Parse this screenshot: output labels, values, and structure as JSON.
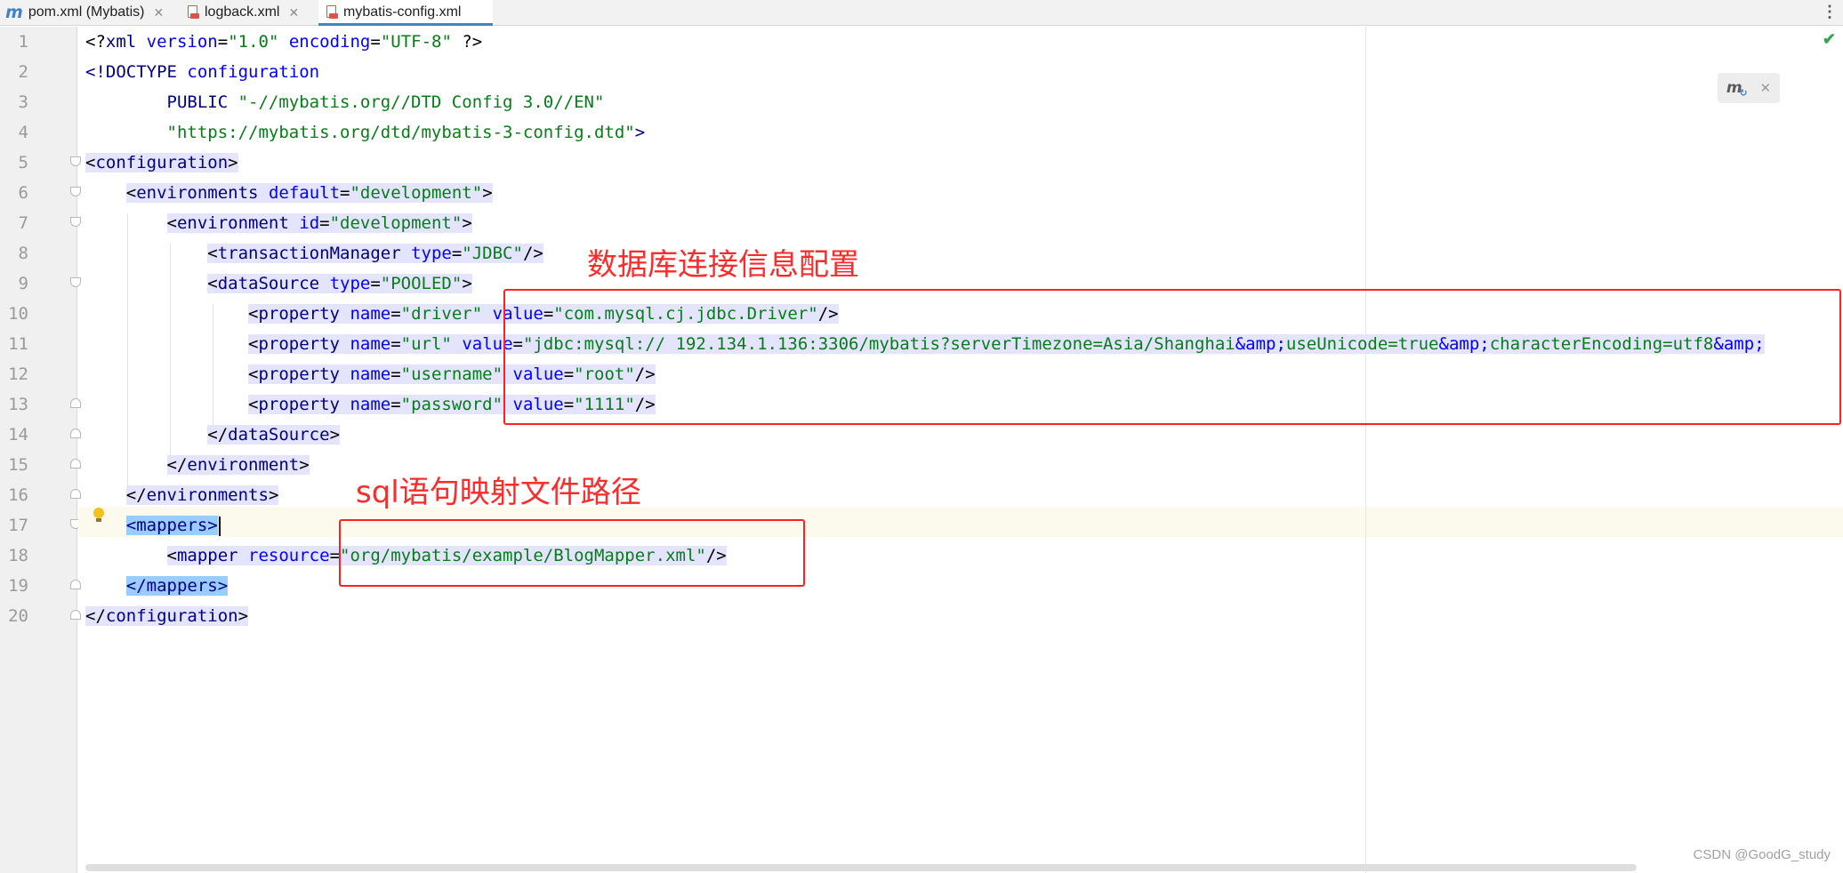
{
  "tabs": [
    {
      "label": "pom.xml (Mybatis)",
      "icon": "maven-m-icon",
      "icon_glyph": "m"
    },
    {
      "label": "logback.xml",
      "icon": "xml-file-icon"
    },
    {
      "label": "mybatis-config.xml",
      "icon": "xml-file-icon",
      "active": true
    }
  ],
  "line_numbers": [
    "1",
    "2",
    "3",
    "4",
    "5",
    "6",
    "7",
    "8",
    "9",
    "10",
    "11",
    "12",
    "13",
    "14",
    "15",
    "16",
    "17",
    "18",
    "19",
    "20"
  ],
  "code": {
    "l1": [
      "<?",
      "xml ",
      "version",
      "=",
      "\"1.0\"",
      " ",
      "encoding",
      "=",
      "\"UTF-8\"",
      " ?>"
    ],
    "l2": [
      "<!DOCTYPE ",
      "configuration"
    ],
    "l3": [
      "        PUBLIC ",
      "\"-//mybatis.org//DTD Config 3.0//EN\""
    ],
    "l4": [
      "        ",
      "\"https://mybatis.org/dtd/mybatis-3-config.dtd\"",
      ">"
    ],
    "l5": [
      "<",
      "configuration",
      ">"
    ],
    "l6": [
      "    ",
      "<",
      "environments ",
      "default",
      "=",
      "\"development\"",
      ">"
    ],
    "l7": [
      "        ",
      "<",
      "environment ",
      "id",
      "=",
      "\"development\"",
      ">"
    ],
    "l8": [
      "            ",
      "<",
      "transactionManager ",
      "type",
      "=",
      "\"JDBC\"",
      "/>"
    ],
    "l9": [
      "            ",
      "<",
      "dataSource ",
      "type",
      "=",
      "\"POOLED\"",
      ">"
    ],
    "l10": [
      "                ",
      "<",
      "property ",
      "name",
      "=",
      "\"driver\"",
      " ",
      "value",
      "=",
      "\"com.mysql.cj.jdbc.Driver\"",
      "/>"
    ],
    "l11": [
      "                ",
      "<",
      "property ",
      "name",
      "=",
      "\"url\"",
      " ",
      "value",
      "=",
      "\"jdbc:mysql:// 192.134.1.136:3306/mybatis?serverTimezone=Asia/Shanghai",
      "&amp;",
      "useUnicode=true",
      "&amp;",
      "characterEncoding=utf8",
      "&amp;"
    ],
    "l12": [
      "                ",
      "<",
      "property ",
      "name",
      "=",
      "\"username\"",
      " ",
      "value",
      "=",
      "\"root\"",
      "/>"
    ],
    "l13": [
      "                ",
      "<",
      "property ",
      "name",
      "=",
      "\"password\"",
      " ",
      "value",
      "=",
      "\"1111\"",
      "/>"
    ],
    "l14": [
      "            ",
      "</",
      "dataSource",
      ">"
    ],
    "l15": [
      "        ",
      "</",
      "environment",
      ">"
    ],
    "l16": [
      "    ",
      "</",
      "environments",
      ">"
    ],
    "l17": [
      "    ",
      "<mappers>"
    ],
    "l18": [
      "        ",
      "<",
      "mapper ",
      "resource",
      "=",
      "\"org/mybatis/example/BlogMapper.xml\"",
      "/>"
    ],
    "l19": [
      "    ",
      "</mappers>"
    ],
    "l20": [
      "</",
      "configuration",
      ">"
    ]
  },
  "annotations": {
    "datasource_label": "数据库连接信息配置",
    "mapper_label": "sql语句映射文件路径"
  },
  "colors": {
    "annotation_red": "#ff2020",
    "tag": "#000080",
    "attribute": "#0000ff",
    "string": "#067d17",
    "active_tab_underline": "#4083c9"
  },
  "watermark": "CSDN @GoodG_study",
  "icons": {
    "tab_menu": "more-vertical-icon",
    "status": "checkmark-icon",
    "maven_popup": "maven-refresh-icon",
    "popup_close": "close-icon",
    "intention": "lightbulb-icon"
  }
}
